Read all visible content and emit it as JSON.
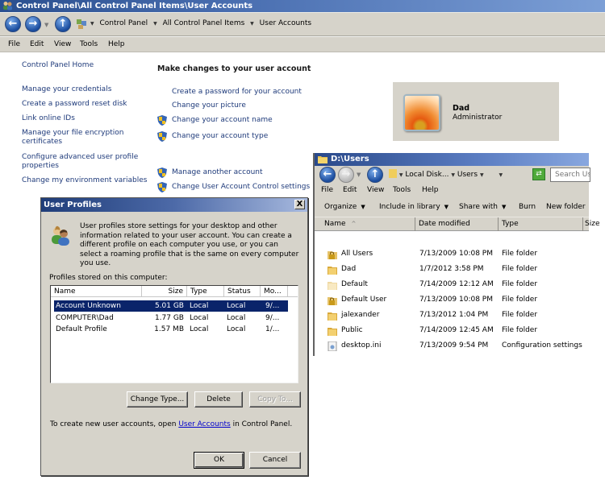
{
  "control_panel": {
    "title": "Control Panel\\All Control Panel Items\\User Accounts",
    "breadcrumbs": [
      "Control Panel",
      "All Control Panel Items",
      "User Accounts"
    ],
    "menu": [
      "File",
      "Edit",
      "View",
      "Tools",
      "Help"
    ],
    "left_links": [
      "Control Panel Home",
      "Manage your credentials",
      "Create a password reset disk",
      "Link online IDs",
      "Manage your file encryption certificates",
      "Configure advanced user profile properties",
      "Change my environment variables"
    ],
    "heading": "Make changes to your user account",
    "tasks": [
      {
        "label": "Create a password for your account",
        "shield": false
      },
      {
        "label": "Change your picture",
        "shield": false
      },
      {
        "label": "Change your account name",
        "shield": true
      },
      {
        "label": "Change your account type",
        "shield": true
      }
    ],
    "other_tasks": [
      {
        "label": "Manage another account",
        "shield": true
      },
      {
        "label": "Change User Account Control settings",
        "shield": true
      }
    ],
    "user": {
      "name": "Dad",
      "role": "Administrator"
    }
  },
  "explorer": {
    "title": "D:\\Users",
    "address": [
      "Local Disk...",
      "Users"
    ],
    "search_placeholder": "Search Users",
    "menu": [
      "File",
      "Edit",
      "View",
      "Tools",
      "Help"
    ],
    "toolbar": [
      "Organize",
      "Include in library",
      "Share with",
      "Burn",
      "New folder"
    ],
    "columns": [
      "Name",
      "Date modified",
      "Type",
      "Size"
    ],
    "sort_indicator": "^",
    "rows": [
      {
        "name": "All Users",
        "date": "7/13/2009 10:08 PM",
        "type": "File folder",
        "icon": "locked-folder-icon"
      },
      {
        "name": "Dad",
        "date": "1/7/2012 3:58 PM",
        "type": "File folder",
        "icon": "folder-icon"
      },
      {
        "name": "Default",
        "date": "7/14/2009 12:12 AM",
        "type": "File folder",
        "icon": "hidden-folder-icon"
      },
      {
        "name": "Default User",
        "date": "7/13/2009 10:08 PM",
        "type": "File folder",
        "icon": "locked-folder-icon"
      },
      {
        "name": "jalexander",
        "date": "7/13/2012 1:04 PM",
        "type": "File folder",
        "icon": "folder-icon"
      },
      {
        "name": "Public",
        "date": "7/14/2009 12:45 AM",
        "type": "File folder",
        "icon": "folder-icon"
      },
      {
        "name": "desktop.ini",
        "date": "7/13/2009 9:54 PM",
        "type": "Configuration settings",
        "icon": "settings-file-icon"
      }
    ]
  },
  "dialog": {
    "title": "User Profiles",
    "close": "X",
    "description": "User profiles store settings for your desktop and other information related to your user account. You can create a different profile on each computer you use, or you can select a roaming profile that is the same on every computer you use.",
    "list_label": "Profiles stored on this computer:",
    "columns": [
      "Name",
      "Size",
      "Type",
      "Status",
      "Mo..."
    ],
    "profiles": [
      {
        "name": "Account Unknown",
        "size": "5.01 GB",
        "type": "Local",
        "status": "Local",
        "modified": "9/...",
        "selected": true
      },
      {
        "name": "COMPUTER\\Dad",
        "size": "1.77 GB",
        "type": "Local",
        "status": "Local",
        "modified": "9/...",
        "selected": false
      },
      {
        "name": "Default Profile",
        "size": "1.57 MB",
        "type": "Local",
        "status": "Local",
        "modified": "1/...",
        "selected": false
      }
    ],
    "buttons": {
      "change_type": "Change Type...",
      "delete": "Delete",
      "copy_to": "Copy To...",
      "ok": "OK",
      "cancel": "Cancel"
    },
    "footer_before": "To create new user accounts, open ",
    "footer_link": "User Accounts",
    "footer_after": " in Control Panel."
  }
}
